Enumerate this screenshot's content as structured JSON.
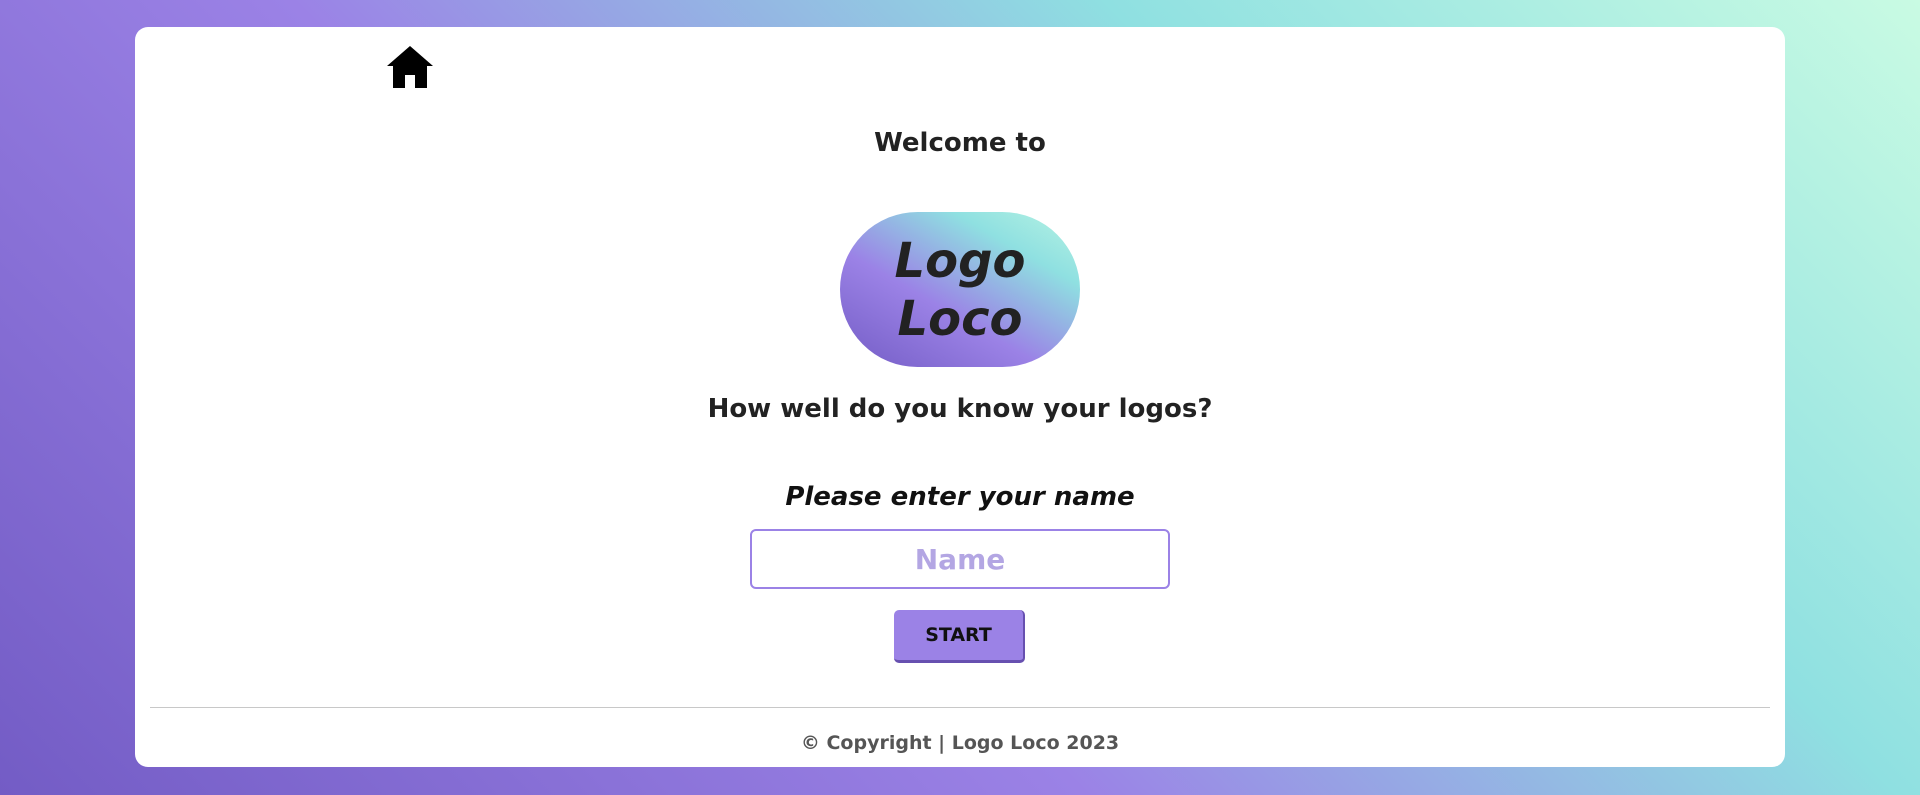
{
  "nav": {
    "home_icon": "home-icon"
  },
  "hero": {
    "welcome_text": "Welcome to",
    "logo_line1": "Logo",
    "logo_line2": "Loco",
    "tagline": "How well do you know your logos?"
  },
  "form": {
    "prompt": "Please enter your name",
    "name_placeholder": "Name",
    "name_value": "",
    "start_label": "START"
  },
  "footer": {
    "copyright_symbol": "©",
    "text": "Copyright | Logo Loco 2023"
  },
  "colors": {
    "accent": "#9b82e6",
    "gradient_start": "#735cc5",
    "gradient_end": "#c9fbe3"
  }
}
